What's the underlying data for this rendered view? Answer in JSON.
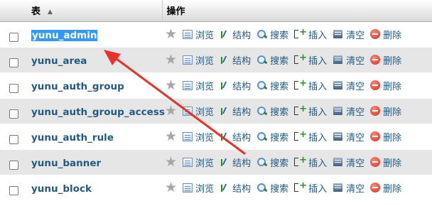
{
  "header": {
    "table_label": "表",
    "ops_label": "操作"
  },
  "actions": {
    "browse": "浏览",
    "structure": "结构",
    "search": "搜索",
    "insert": "插入",
    "empty": "清空",
    "drop": "删除"
  },
  "rows": [
    {
      "name": "yunu_admin",
      "selected": true
    },
    {
      "name": "yunu_area"
    },
    {
      "name": "yunu_auth_group"
    },
    {
      "name": "yunu_auth_group_access"
    },
    {
      "name": "yunu_auth_rule"
    },
    {
      "name": "yunu_banner"
    },
    {
      "name": "yunu_block"
    }
  ],
  "colors": {
    "link": "#235a81",
    "selection": "#3399ff",
    "arrow": "#e8322c",
    "row_alt": "#e6e6e6"
  }
}
